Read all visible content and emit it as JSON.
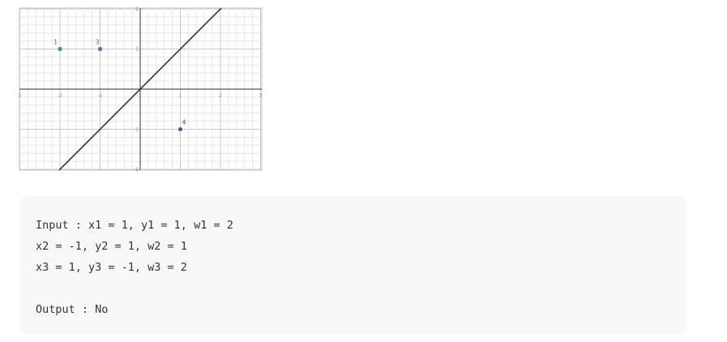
{
  "graph": {
    "x_ticks": [
      "-2",
      "-1",
      "1",
      "2",
      "3"
    ],
    "edge_left_label": "3",
    "y_ticks": [
      "2",
      "1",
      "-1",
      "-2"
    ],
    "points": [
      {
        "label": "1",
        "x": -2,
        "y": 1,
        "color": "#3a9a4a"
      },
      {
        "label": "3",
        "x": -1,
        "y": 1,
        "color": "#3f6fa8"
      },
      {
        "label": "4",
        "x": 1,
        "y": -1,
        "color": "#5a4aa0"
      }
    ],
    "line": {
      "slope": 1,
      "intercept": 0,
      "color": "#333333"
    },
    "colors": {
      "grid_minor": "#e6e6e6",
      "grid_major": "#c8c8c8",
      "axis": "#555555",
      "tick_text": "#888888"
    }
  },
  "example": {
    "lines": [
      "Input : x1 = 1, y1 = 1, w1 = 2",
      "x2 = -1, y2 = 1, w2 = 1",
      "x3 = 1, y3 = -1, w3 = 2",
      "",
      "Output : No"
    ]
  }
}
